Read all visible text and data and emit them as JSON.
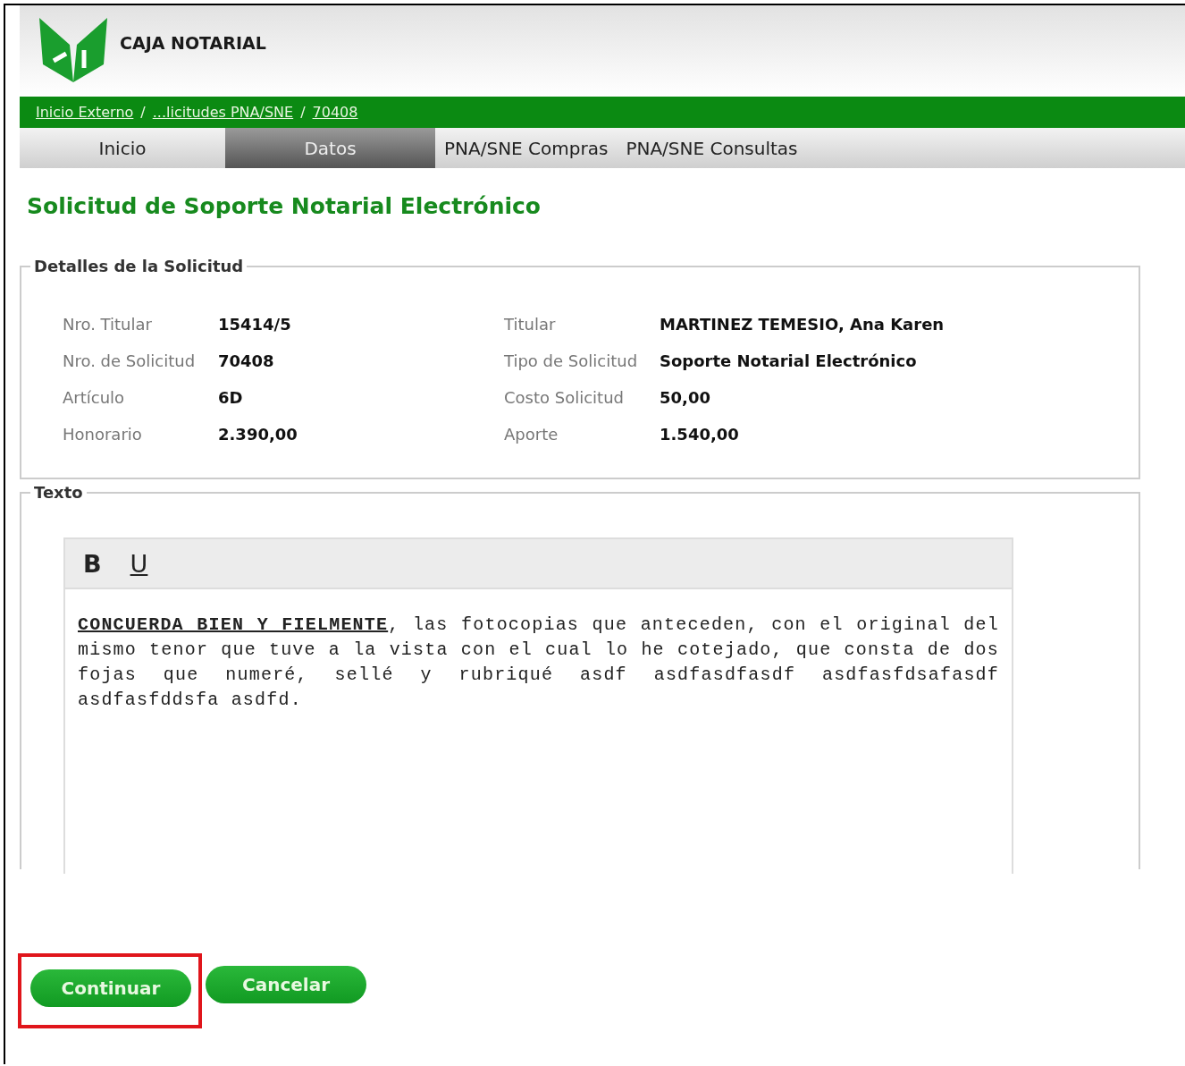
{
  "header": {
    "brand": "CAJA NOTARIAL"
  },
  "breadcrumb": {
    "separator": "/",
    "items": [
      "Inicio Externo",
      "...licitudes PNA/SNE",
      "70408"
    ]
  },
  "tabs": [
    {
      "label": "Inicio",
      "selected": false
    },
    {
      "label": "Datos",
      "selected": true
    },
    {
      "label": "PNA/SNE Compras",
      "selected": false
    },
    {
      "label": "PNA/SNE Consultas",
      "selected": false
    }
  ],
  "page_title": "Solicitud de Soporte Notarial Electrónico",
  "details": {
    "legend": "Detalles de la Solicitud",
    "fields": [
      {
        "label": "Nro. Titular",
        "value": "15414/5"
      },
      {
        "label": "Titular",
        "value": "MARTINEZ TEMESIO, Ana Karen"
      },
      {
        "label": "Nro. de Solicitud",
        "value": "70408"
      },
      {
        "label": "Tipo de Solicitud",
        "value": "Soporte Notarial Electrónico"
      },
      {
        "label": "Artículo",
        "value": "6D"
      },
      {
        "label": "Costo Solicitud",
        "value": "50,00"
      },
      {
        "label": "Honorario",
        "value": "2.390,00"
      },
      {
        "label": "Aporte",
        "value": "1.540,00"
      }
    ]
  },
  "text_section": {
    "legend": "Texto",
    "toolbar": [
      "B",
      "U"
    ],
    "content": "**CONCUERDA BIEN Y FIELMENTE**, las fotocopias que anteceden, con el original del mismo tenor que tuve a la vista con el cual lo he cotejado, que consta de dos fojas que numeré, sellé y rubriqué asdf asdfasdfasdf asdfasfdsafasdf asdfasfddsfa asdfd."
  },
  "buttons": [
    {
      "label": "Continuar",
      "highlighted": true
    },
    {
      "label": "Cancelar",
      "highlighted": false
    }
  ]
}
